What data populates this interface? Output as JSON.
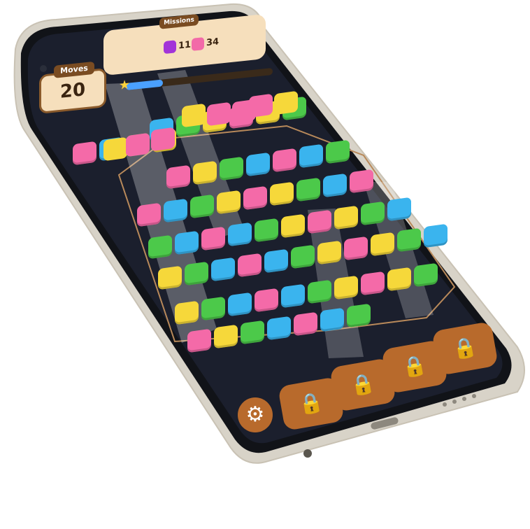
{
  "hud": {
    "moves_label": "Moves",
    "moves_value": "20",
    "missions_label": "Missions",
    "goals": [
      {
        "color": "#a234d8",
        "count": "11"
      },
      {
        "color": "#f26aa8",
        "count": "34"
      }
    ],
    "progress": 0.25
  },
  "boosters": [
    {
      "icon": "lock-icon",
      "locked": true
    },
    {
      "icon": "lock-icon",
      "locked": true
    },
    {
      "icon": "lock-icon",
      "locked": true
    },
    {
      "icon": "lock-icon",
      "locked": true
    }
  ],
  "settings_icon": "gear-icon",
  "colors": {
    "pink": "#f46aa8",
    "yellow": "#f6d83a",
    "green": "#4cc94a",
    "blue": "#3ab4ee",
    "purple": "#a234d8",
    "board": "#1b1f2d",
    "wood": "#b86a2c",
    "panel": "#f6dfbc"
  }
}
